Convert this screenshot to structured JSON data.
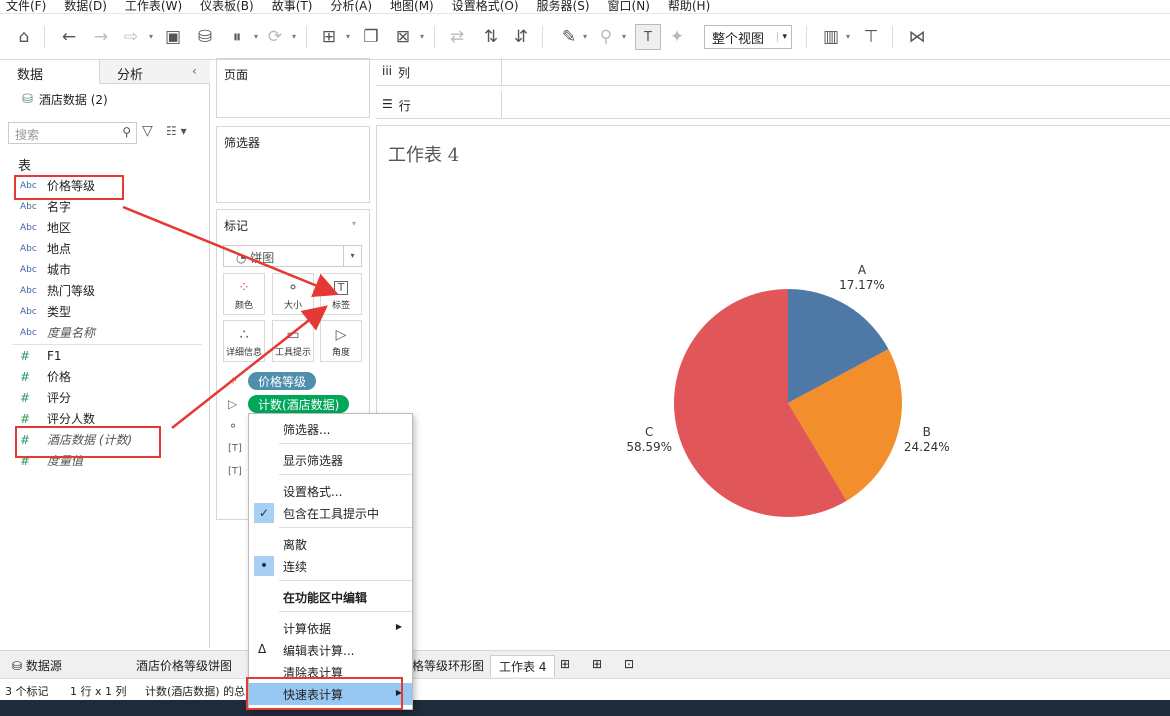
{
  "menubar": [
    "文件(F)",
    "数据(D)",
    "工作表(W)",
    "仪表板(B)",
    "故事(T)",
    "分析(A)",
    "地图(M)",
    "设置格式(O)",
    "服务器(S)",
    "窗口(N)",
    "帮助(H)"
  ],
  "toolbar": {
    "view_select": "整个视图",
    "icons": [
      "home-icon",
      "undo-icon",
      "redo-icon",
      "replay-icon",
      "save-icon",
      "new-datasource-icon",
      "pause-updates-icon",
      "refresh-icon",
      "new-worksheet-icon",
      "duplicate-icon",
      "clear-sheet-icon",
      "swap-icon",
      "sort-asc-icon",
      "sort-desc-icon",
      "highlight-icon",
      "group-icon",
      "label-icon",
      "pin-icon",
      "show-me-icon",
      "presentation-icon",
      "share-icon"
    ]
  },
  "left_panel": {
    "tab_data": "数据",
    "tab_analysis": "分析",
    "datasource": "酒店数据 (2)",
    "search_placeholder": "搜索",
    "table_header": "表",
    "abc_label": "Abc",
    "dimensions": [
      "价格等级",
      "名字",
      "地区",
      "地点",
      "城市",
      "热门等级",
      "类型"
    ],
    "measure_names": "度量名称",
    "measures": [
      "F1",
      "价格",
      "评分",
      "评分人数"
    ],
    "count_field": "酒店数据 (计数)",
    "measure_values": "度量值"
  },
  "shelves": {
    "pages": "页面",
    "filters": "筛选器",
    "marks": "标记",
    "columns": "列",
    "rows": "行",
    "mark_type": "饼图",
    "mark_buttons": [
      "颜色",
      "大小",
      "标签",
      "详细信息",
      "工具提示",
      "角度"
    ],
    "pills": [
      {
        "label": "价格等级",
        "color": "#4d8fac"
      },
      {
        "label": "计数(酒店数据)",
        "color": "#00a65a"
      }
    ]
  },
  "view": {
    "title": "工作表 4"
  },
  "chart_data": {
    "type": "pie",
    "title": "工作表 4",
    "categories": [
      "A",
      "B",
      "C"
    ],
    "values": [
      17.17,
      24.24,
      58.59
    ],
    "labels": [
      "17.17%",
      "24.24%",
      "58.59%"
    ],
    "colors": [
      "#4e79a7",
      "#f28e2b",
      "#e15759"
    ]
  },
  "context_menu": {
    "items": [
      {
        "label": "筛选器..."
      },
      {
        "label": "显示筛选器"
      },
      {
        "label": "设置格式..."
      },
      {
        "label": "包含在工具提示中",
        "checked": true
      },
      {
        "label": "离散"
      },
      {
        "label": "连续",
        "selected": true
      },
      {
        "label": "在功能区中编辑",
        "bold": true
      },
      {
        "label": "计算依据",
        "submenu": true
      },
      {
        "label": "编辑表计算..."
      },
      {
        "label": "清除表计算"
      },
      {
        "label": "快速表计算",
        "submenu": true,
        "highlighted": true
      }
    ]
  },
  "sheet_tabs": {
    "datasource": "数据源",
    "tabs": [
      "酒店价格等级饼图",
      "格等级环形图",
      "工作表 4"
    ],
    "active": "工作表 4"
  },
  "status": {
    "marks": "3 个标记",
    "rows_cols": "1 行 x 1 列",
    "sum": "计数(酒店数据) 的总计"
  },
  "colors": {
    "annotation_red": "#e53935",
    "menu_highlight": "#96c8f2"
  }
}
